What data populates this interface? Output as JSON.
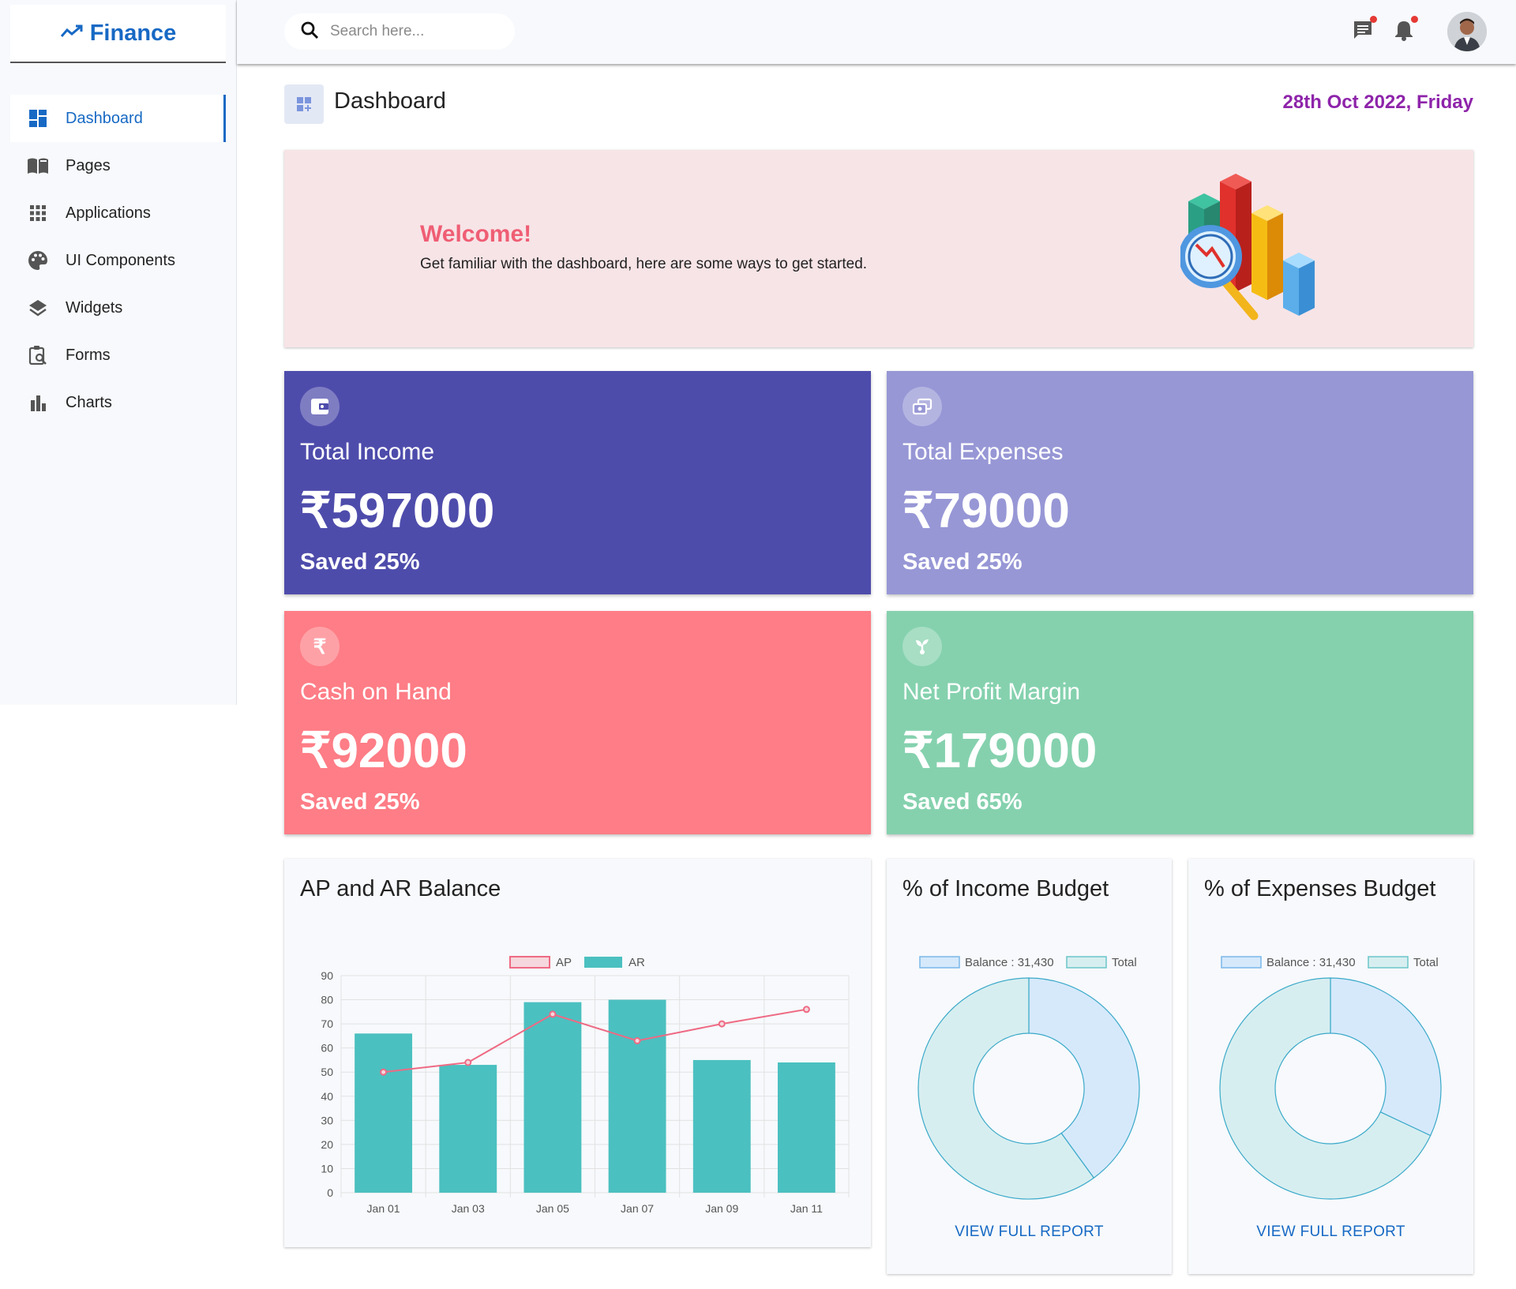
{
  "brand": {
    "name": "Finance",
    "icon": "trending-up-icon"
  },
  "sidebar": {
    "items": [
      {
        "label": "Dashboard",
        "icon": "dashboard-icon",
        "active": true
      },
      {
        "label": "Pages",
        "icon": "book-icon",
        "active": false
      },
      {
        "label": "Applications",
        "icon": "apps-grid-icon",
        "active": false
      },
      {
        "label": "UI Components",
        "icon": "palette-icon",
        "active": false
      },
      {
        "label": "Widgets",
        "icon": "layers-icon",
        "active": false
      },
      {
        "label": "Forms",
        "icon": "clipboard-search-icon",
        "active": false
      },
      {
        "label": "Charts",
        "icon": "bar-chart-icon",
        "active": false
      }
    ]
  },
  "header": {
    "search_placeholder": "Search here...",
    "messages_icon": "chat-icon",
    "notifications_icon": "bell-icon",
    "badge_color": "#e53935"
  },
  "page": {
    "title": "Dashboard",
    "date": "28th Oct 2022, Friday"
  },
  "welcome": {
    "title": "Welcome!",
    "text": "Get familiar with the dashboard, here are some ways to get started."
  },
  "stats": [
    {
      "title": "Total Income",
      "value": "₹597000",
      "sub": "Saved 25%",
      "color": "#4e4cab",
      "icon": "wallet-icon"
    },
    {
      "title": "Total Expenses",
      "value": "₹79000",
      "sub": "Saved 25%",
      "color": "#9797d6",
      "icon": "money-transfer-icon"
    },
    {
      "title": "Cash on Hand",
      "value": "₹92000",
      "sub": "Saved 25%",
      "color": "#fe7d86",
      "icon": "rupee-icon"
    },
    {
      "title": "Net Profit Margin",
      "value": "₹179000",
      "sub": "Saved 65%",
      "color": "#85d1ae",
      "icon": "plant-icon"
    }
  ],
  "bar_panel": {
    "title": "AP and AR Balance"
  },
  "income_panel": {
    "title": "% of Income Budget",
    "link": "VIEW FULL REPORT"
  },
  "expenses_panel": {
    "title": "% of Expenses Budget",
    "link": "VIEW FULL REPORT"
  },
  "chart_data": [
    {
      "type": "bar",
      "title": "AP and AR Balance",
      "categories": [
        "Jan 01",
        "Jan 03",
        "Jan 05",
        "Jan 07",
        "Jan 09",
        "Jan 11"
      ],
      "series": [
        {
          "name": "AP",
          "type": "line",
          "values": [
            50,
            54,
            74,
            63,
            70,
            76
          ],
          "color": "#ef6a84"
        },
        {
          "name": "AR",
          "type": "bar",
          "values": [
            66,
            53,
            79,
            80,
            55,
            54
          ],
          "color": "#4bc0c0"
        }
      ],
      "ylim": [
        0,
        90
      ],
      "yticks": [
        0,
        10,
        20,
        30,
        40,
        50,
        60,
        70,
        80,
        90
      ],
      "grid": true,
      "legend": "top-center"
    },
    {
      "type": "pie",
      "title": "% of Income Budget",
      "labels": [
        "Balance : 31,430",
        "Total"
      ],
      "values": [
        40,
        60
      ],
      "colors": [
        "#d6e9fb",
        "#d7eef0"
      ],
      "legend": "top"
    },
    {
      "type": "pie",
      "title": "% of Expenses Budget",
      "labels": [
        "Balance : 31,430",
        "Total"
      ],
      "values": [
        32,
        68
      ],
      "colors": [
        "#d6e9fb",
        "#d7eef0"
      ],
      "legend": "top"
    }
  ]
}
